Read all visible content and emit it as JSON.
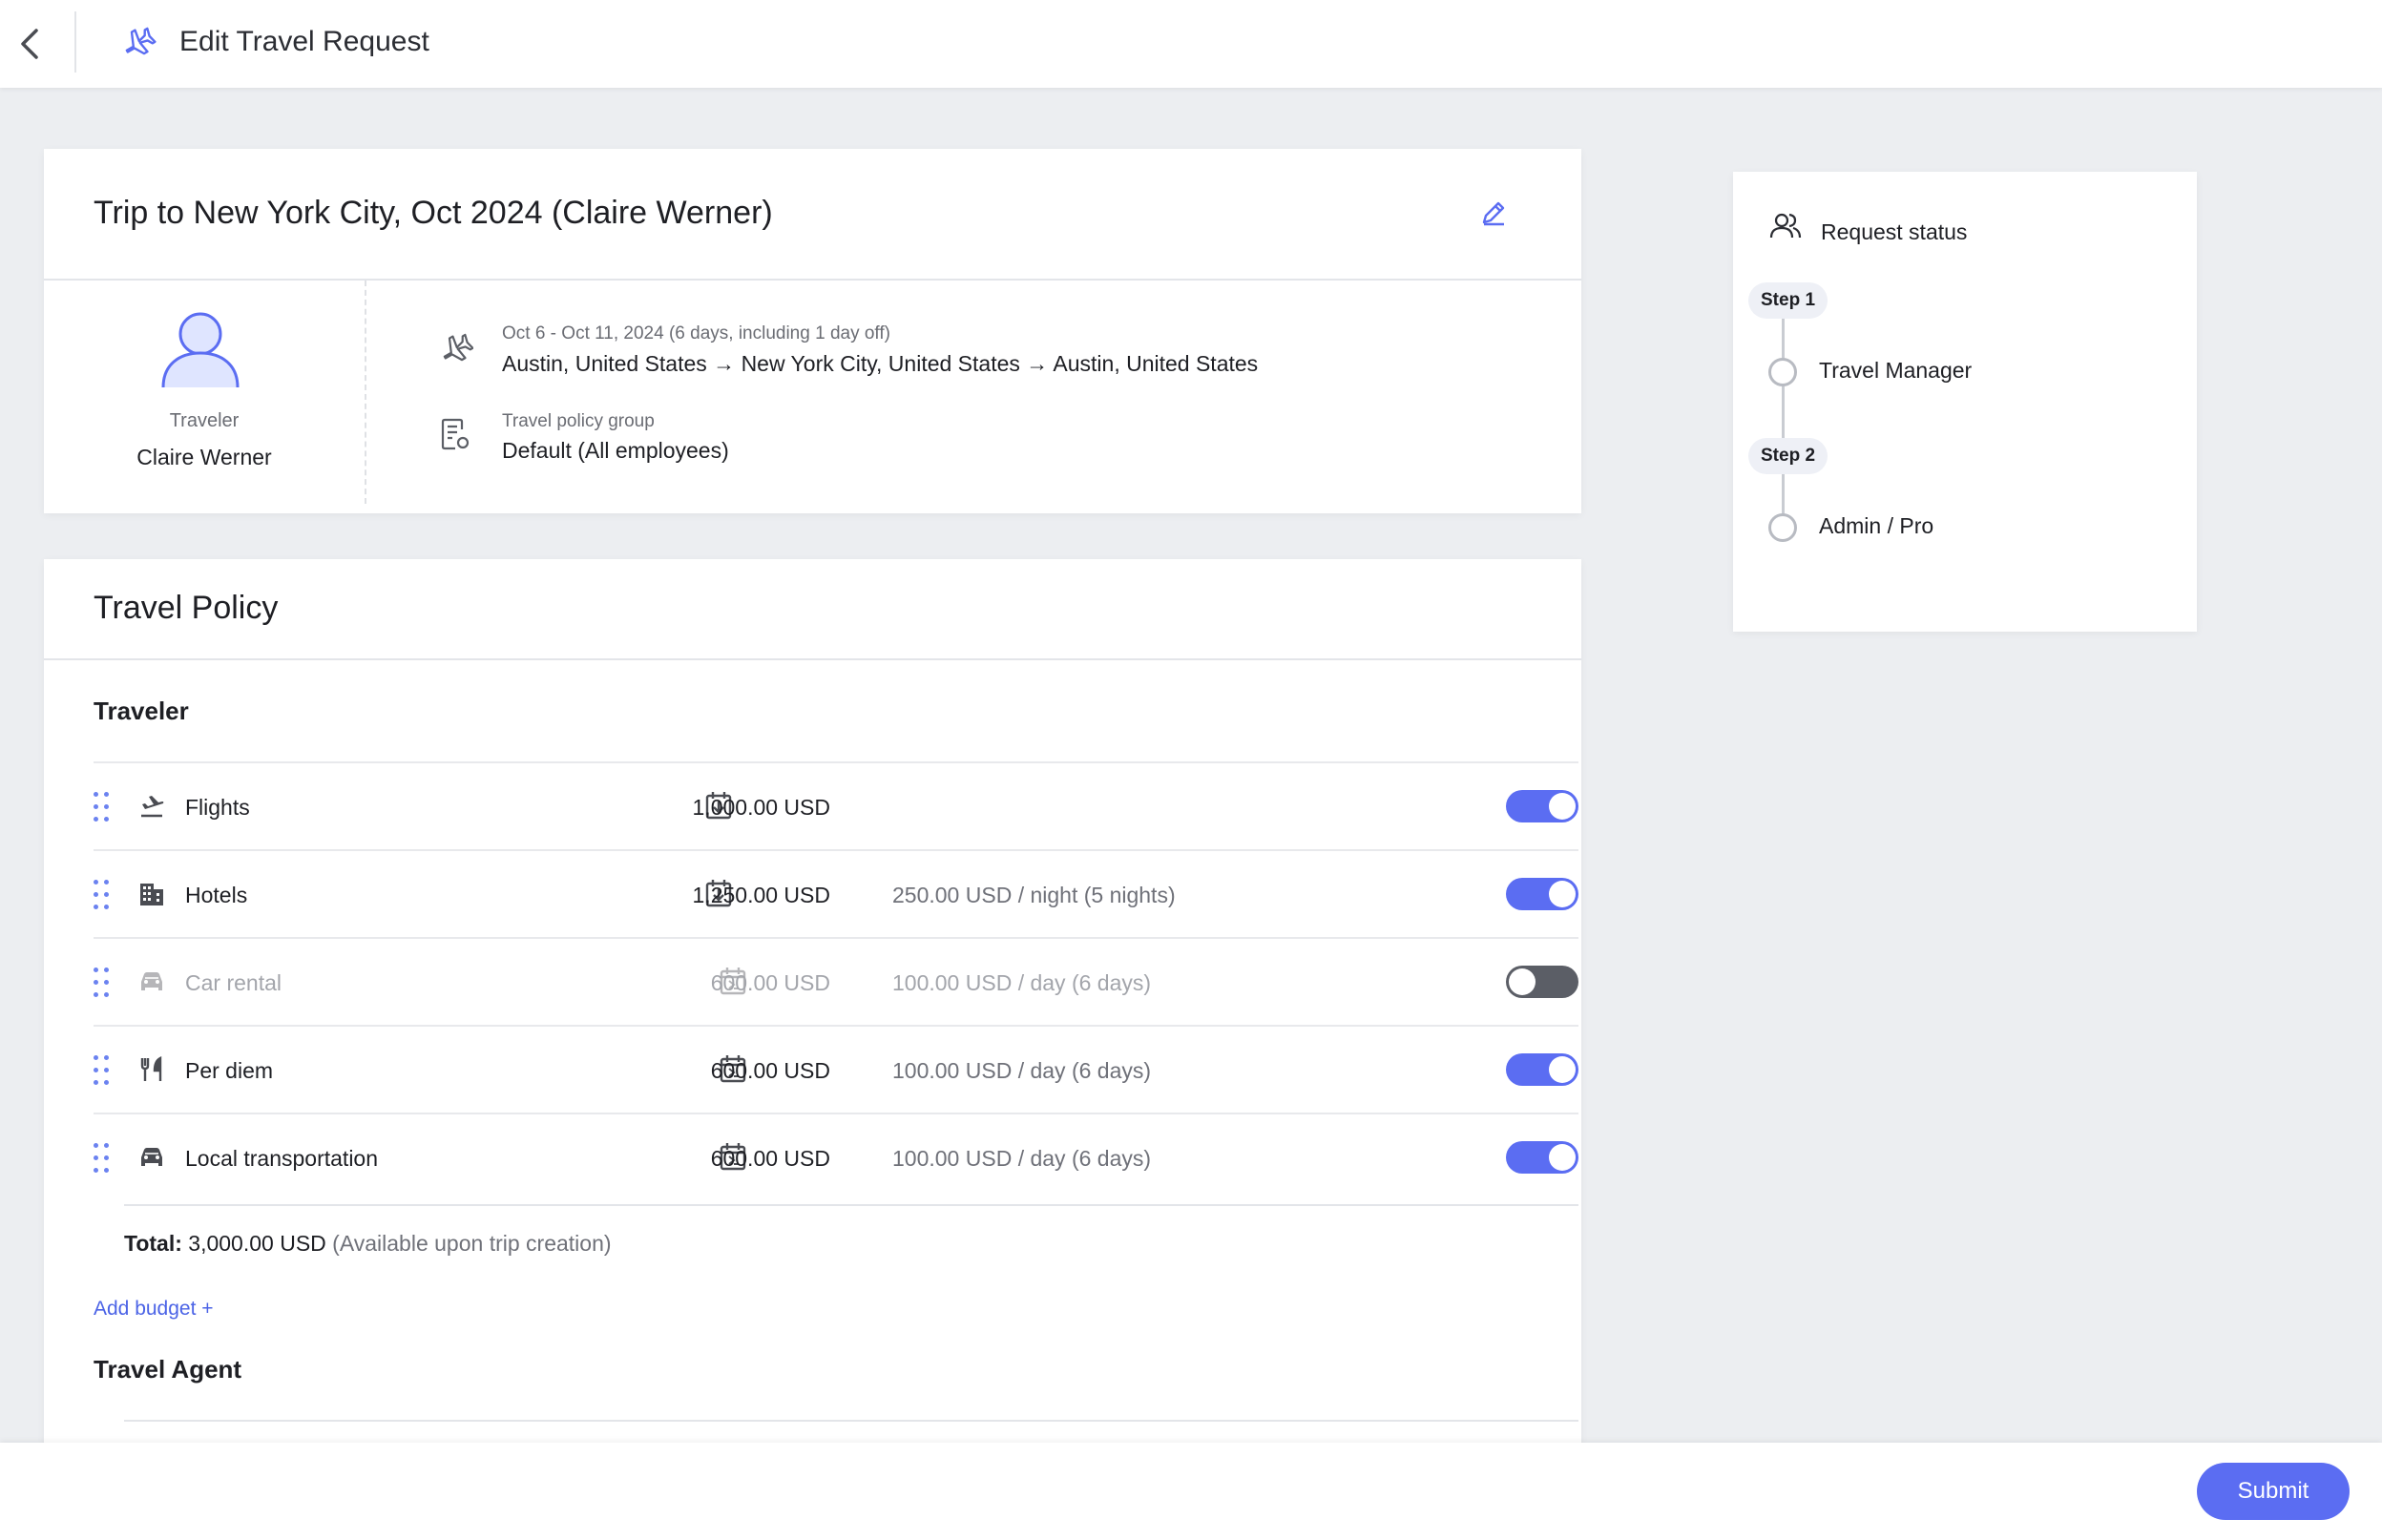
{
  "header": {
    "title": "Edit Travel Request"
  },
  "trip": {
    "title": "Trip to New York City, Oct 2024 (Claire Werner)",
    "traveler_label": "Traveler",
    "traveler_name": "Claire Werner",
    "dates": "Oct 6 - Oct 11, 2024 (6 days, including 1 day off)",
    "route": "Austin, United States → New York City, United States → Austin, United States",
    "policy_group_label": "Travel policy group",
    "policy_group": "Default (All employees)"
  },
  "policy": {
    "title": "Travel Policy",
    "traveler_section": "Traveler",
    "rows": [
      {
        "label": "Flights",
        "amount": "1,000.00 USD",
        "rate": "",
        "enabled": true,
        "icon": "flight-takeoff-icon"
      },
      {
        "label": "Hotels",
        "amount": "1,250.00 USD",
        "rate": "250.00 USD / night (5 nights)",
        "enabled": true,
        "icon": "building-icon"
      },
      {
        "label": "Car rental",
        "amount": "600.00 USD",
        "rate": "100.00 USD / day (6 days)",
        "enabled": false,
        "icon": "car-icon"
      },
      {
        "label": "Per diem",
        "amount": "600.00 USD",
        "rate": "100.00 USD / day (6 days)",
        "enabled": true,
        "icon": "utensils-icon"
      },
      {
        "label": "Local transportation",
        "amount": "600.00 USD",
        "rate": "100.00 USD / day (6 days)",
        "enabled": true,
        "icon": "car-icon"
      }
    ],
    "total_label": "Total:",
    "total_value": "3,000.00 USD",
    "total_note": "(Available upon trip creation)",
    "add_budget": "Add budget +",
    "agent_section": "Travel Agent"
  },
  "status": {
    "title": "Request status",
    "steps": [
      {
        "badge": "Step 1",
        "name": "Travel Manager"
      },
      {
        "badge": "Step 2",
        "name": "Admin / Pro"
      }
    ]
  },
  "footer": {
    "submit": "Submit"
  },
  "colors": {
    "accent": "#5b6df2",
    "link": "#4b63e6",
    "toggle_off": "#5b5e66",
    "background": "#eceef1"
  }
}
